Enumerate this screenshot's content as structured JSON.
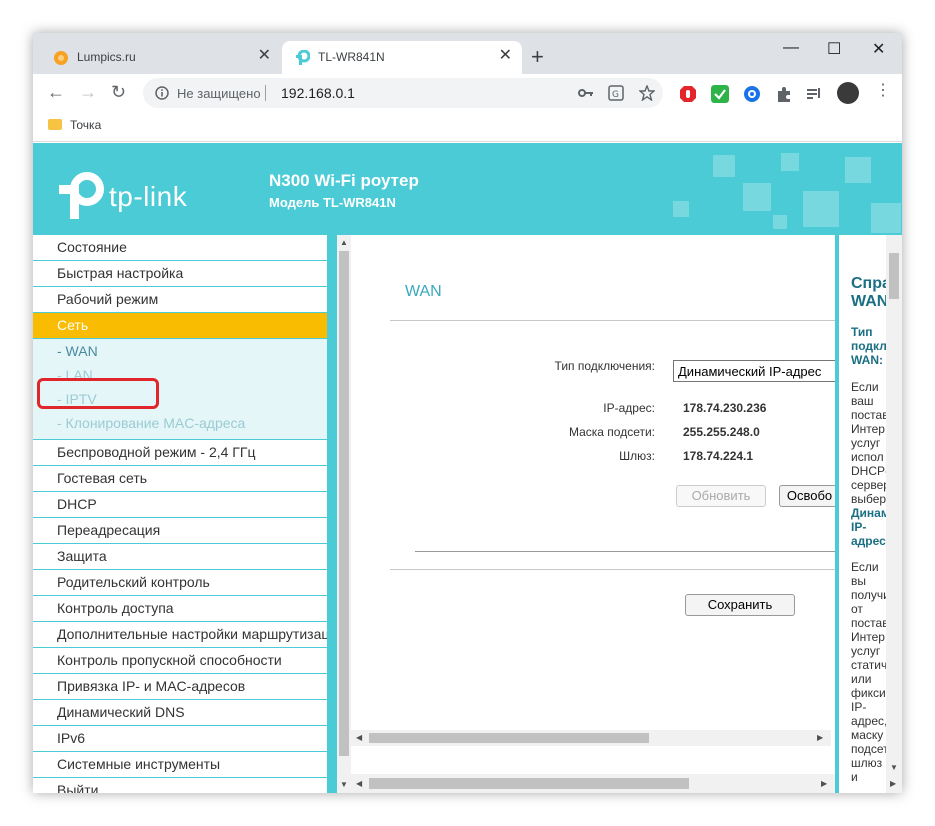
{
  "browser": {
    "tabs": [
      {
        "label": "Lumpics.ru",
        "close": "✕"
      },
      {
        "label": "TL-WR841N",
        "close": "✕"
      }
    ],
    "new_tab": "+",
    "window_controls": {
      "minimize": "—",
      "maximize": "☐",
      "close": "✕"
    },
    "nav": {
      "back": "←",
      "forward": "→",
      "reload": "↻"
    },
    "address": {
      "security_text": "Не защищено",
      "url": "192.168.0.1"
    },
    "bookmarks": [
      {
        "label": "Точка"
      }
    ]
  },
  "router": {
    "brand": "tp-link",
    "product": "N300 Wi-Fi роутер",
    "model": "Модель TL-WR841N",
    "accent_color": "#4acbd6",
    "active_color": "#f9bc00"
  },
  "sidebar": {
    "items_top": [
      {
        "label": "Состояние"
      },
      {
        "label": "Быстрая настройка"
      },
      {
        "label": "Рабочий режим"
      },
      {
        "label": "Сеть",
        "active": true
      }
    ],
    "submenu": [
      {
        "label": "- WAN"
      },
      {
        "label": "- LAN"
      },
      {
        "label": "- IPTV"
      },
      {
        "label": "- Клонирование MAC-адреса"
      }
    ],
    "items_bottom": [
      {
        "label": "Беспроводной режим - 2,4 ГГц"
      },
      {
        "label": "Гостевая сеть"
      },
      {
        "label": "DHCP"
      },
      {
        "label": "Переадресация"
      },
      {
        "label": "Защита"
      },
      {
        "label": "Родительский контроль"
      },
      {
        "label": "Контроль доступа"
      },
      {
        "label": "Дополнительные настройки маршрутизации"
      },
      {
        "label": "Контроль пропускной способности"
      },
      {
        "label": "Привязка IP- и MAC-адресов"
      },
      {
        "label": "Динамический DNS"
      },
      {
        "label": "IPv6"
      },
      {
        "label": "Системные инструменты"
      },
      {
        "label": "Выйти"
      }
    ]
  },
  "main": {
    "title": "WAN",
    "connection_type_label": "Тип подключения:",
    "connection_type_value": "Динамический IP-адрес",
    "ip_label": "IP-адрес:",
    "ip_value": "178.74.230.236",
    "mask_label": "Маска подсети:",
    "mask_value": "255.255.248.0",
    "gateway_label": "Шлюз:",
    "gateway_value": "178.74.224.1",
    "refresh_button": "Обновить",
    "release_button": "Освобо",
    "save_button": "Сохранить"
  },
  "help": {
    "heading": "Спра\nWAN",
    "subheading": "Тип\nподкл\nWAN:",
    "p1": "Если\nваш\nпостав\nИнтер\nуслуг\nиспол\nDHCP-\nсервер\nвыбер",
    "p1_bold": "Динам\nIP-\nадрес",
    "p2": "Если\nвы\nполучи\nот\nпостав\nИнтер\nуслуг\nстатич\nили\nфикси\nIP-\nадрес,\nмаску\nподсет\nшлюз\nи"
  }
}
